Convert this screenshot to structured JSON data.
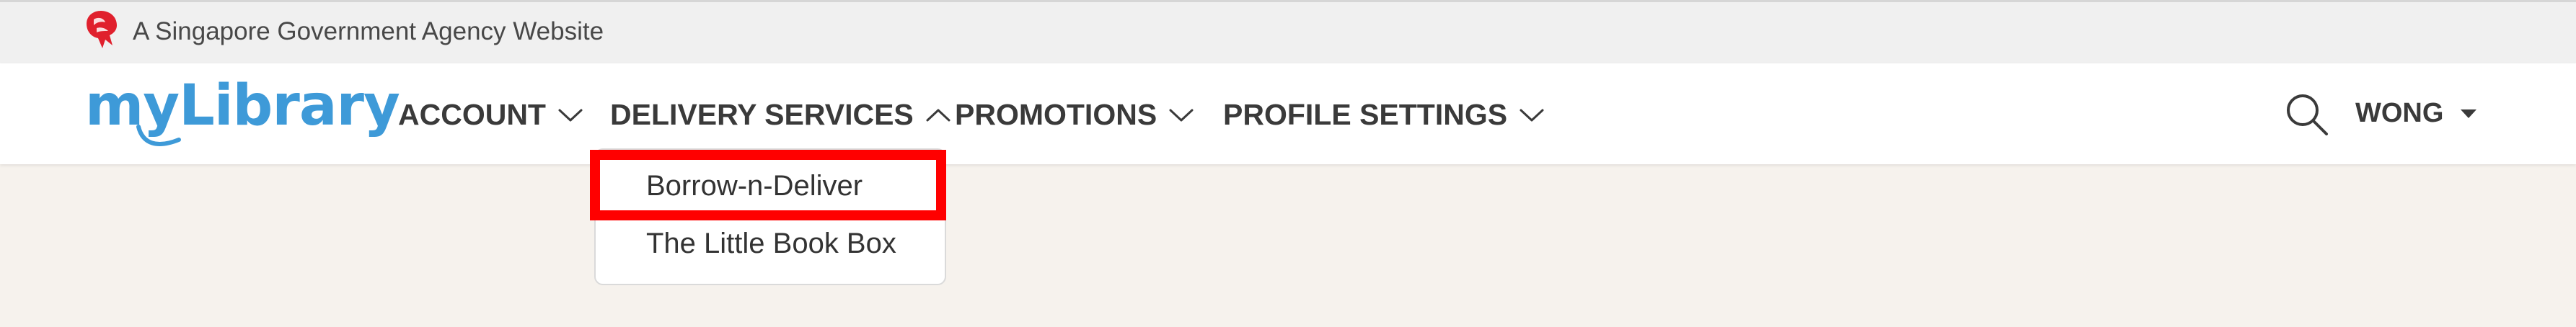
{
  "masthead": {
    "agency_text": "A Singapore Government Agency Website",
    "icon": "lion-head-icon"
  },
  "header": {
    "logo_text": "myLibrary",
    "nav": [
      {
        "label": "ACCOUNT",
        "icon": "chevron-down-icon"
      },
      {
        "label": "DELIVERY SERVICES",
        "icon": "chevron-up-icon",
        "expanded": true
      },
      {
        "label": "PROMOTIONS",
        "icon": "chevron-down-icon"
      },
      {
        "label": "PROFILE SETTINGS",
        "icon": "chevron-down-icon"
      }
    ],
    "search_icon": "search-icon",
    "user": {
      "name": "WONG",
      "icon": "caret-down-icon"
    }
  },
  "dropdown": {
    "items": [
      {
        "label": "Borrow-n-Deliver",
        "highlighted": true
      },
      {
        "label": "The Little Book Box"
      }
    ]
  },
  "colors": {
    "brand_blue": "#3e9ad8",
    "page_background": "#f6f2ed",
    "masthead_background": "#f0f0f0",
    "lion_red": "#e0202d",
    "highlight_red": "#ff0000"
  }
}
